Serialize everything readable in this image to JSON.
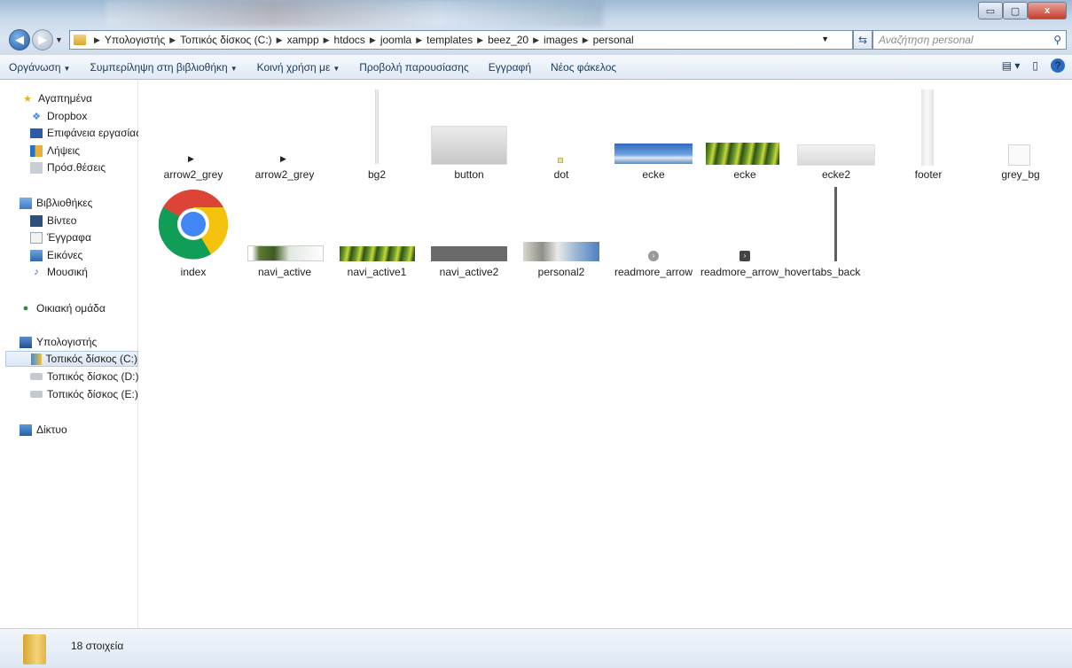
{
  "window": {
    "buttons": {
      "minimize": "▭",
      "maximize": "▢",
      "close": "x"
    }
  },
  "address": {
    "crumbs": [
      "Υπολογιστής",
      "Τοπικός δίσκος (C:)",
      "xampp",
      "htdocs",
      "joomla",
      "templates",
      "beez_20",
      "images",
      "personal"
    ]
  },
  "search": {
    "placeholder": "Αναζήτηση personal"
  },
  "toolbar": {
    "organize": "Οργάνωση",
    "include_library": "Συμπερίληψη στη βιβλιοθήκη",
    "share_with": "Κοινή χρήση με",
    "slideshow": "Προβολή παρουσίασης",
    "burn": "Εγγραφή",
    "new_folder": "Νέος φάκελος"
  },
  "sidebar": {
    "favorites": "Αγαπημένα",
    "dropbox": "Dropbox",
    "desktop": "Επιφάνεια εργασίας",
    "downloads": "Λήψεις",
    "recent": "Πρόσ.θέσεις",
    "libraries": "Βιβλιοθήκες",
    "videos": "Βίντεο",
    "documents": "Έγγραφα",
    "pictures": "Εικόνες",
    "music": "Μουσική",
    "homegroup": "Οικιακή ομάδα",
    "computer": "Υπολογιστής",
    "drive_c": "Τοπικός δίσκος (C:)",
    "drive_d": "Τοπικός δίσκος (D:)",
    "drive_e": "Τοπικός δίσκος (E:)",
    "network": "Δίκτυο"
  },
  "files": [
    {
      "name": "arrow2_grey"
    },
    {
      "name": "arrow2_grey"
    },
    {
      "name": "bg2"
    },
    {
      "name": "button"
    },
    {
      "name": "dot"
    },
    {
      "name": "ecke"
    },
    {
      "name": "ecke"
    },
    {
      "name": "ecke2"
    },
    {
      "name": "footer"
    },
    {
      "name": "grey_bg"
    },
    {
      "name": "index"
    },
    {
      "name": "navi_active"
    },
    {
      "name": "navi_active1"
    },
    {
      "name": "navi_active2"
    },
    {
      "name": "personal2"
    },
    {
      "name": "readmore_arrow"
    },
    {
      "name": "readmore_arrow_hover"
    },
    {
      "name": "tabs_back"
    }
  ],
  "status": {
    "count": "18 στοιχεία"
  }
}
